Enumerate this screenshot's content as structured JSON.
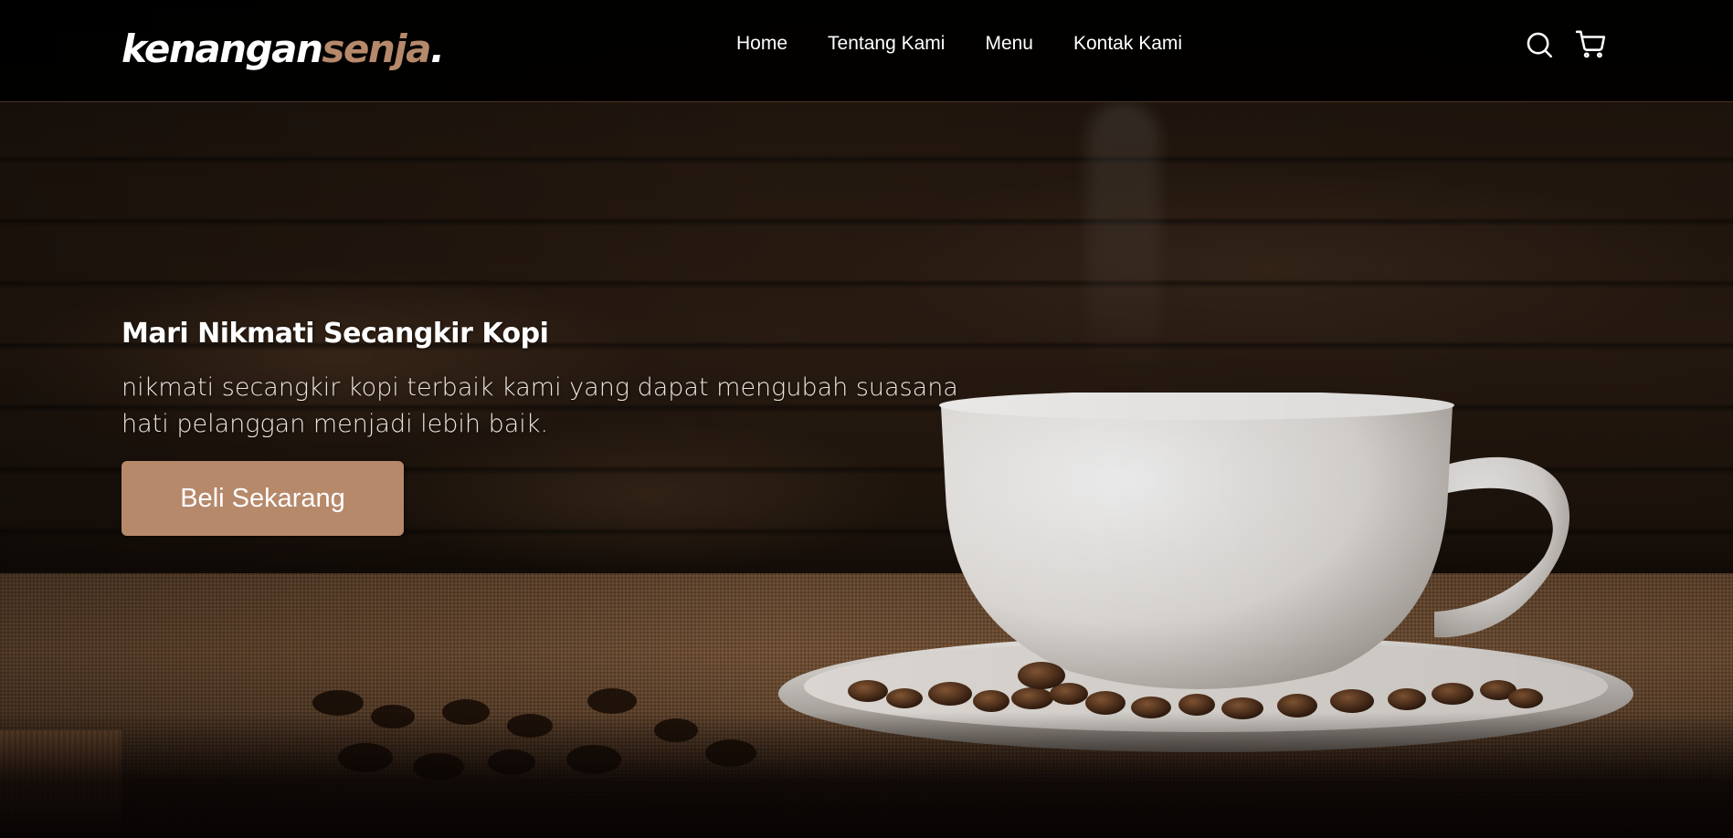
{
  "brand": {
    "name_part1": "kenangan",
    "name_part2": "senja",
    "dot": ".",
    "accent_color": "#b6896b"
  },
  "nav": {
    "links": [
      {
        "label": "Home"
      },
      {
        "label": "Tentang Kami"
      },
      {
        "label": "Menu"
      },
      {
        "label": "Kontak Kami"
      }
    ],
    "icons": [
      "search-icon",
      "shopping-cart-icon"
    ]
  },
  "hero": {
    "title": "Mari Nikmati Secangkir Kopi",
    "text": "nikmati secangkir kopi terbaik kami yang dapat mengubah suasana hati pelanggan menjadi lebih baik.",
    "cta_label": "Beli Sekarang",
    "background_image": "coffee-cup-on-saucer-with-beans"
  }
}
